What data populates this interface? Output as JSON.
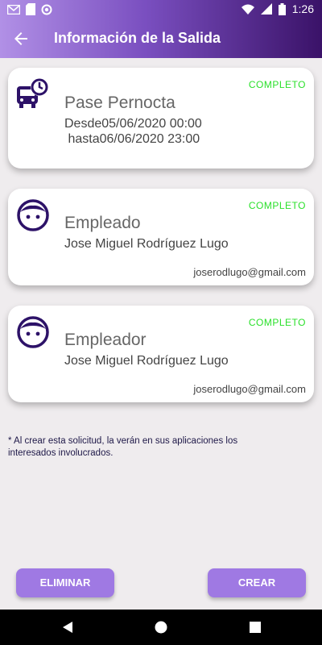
{
  "status_bar": {
    "time": "1:26"
  },
  "app_bar": {
    "title": "Información de la Salida"
  },
  "cards": [
    {
      "status": "COMPLETO",
      "heading": "Pase Pernocta",
      "line1": "Desde05/06/2020 00:00",
      "line2": " hasta06/06/2020 23:00",
      "icon": "bus-clock-icon"
    },
    {
      "status": "COMPLETO",
      "heading": "Empleado",
      "name": "Jose Miguel Rodríguez Lugo",
      "email": "joserodlugo@gmail.com",
      "icon": "person-face-icon"
    },
    {
      "status": "COMPLETO",
      "heading": "Empleador",
      "name": "Jose Miguel Rodríguez Lugo",
      "email": "joserodlugo@gmail.com",
      "icon": "person-face-icon"
    }
  ],
  "note": "* Al crear esta solicitud, la verán en sus aplicaciones los interesados involucrados.",
  "buttons": {
    "delete": "ELIMINAR",
    "create": "CREAR"
  },
  "colors": {
    "accent": "#9f79e3",
    "complete": "#2be02b",
    "icon": "#2d1268"
  }
}
